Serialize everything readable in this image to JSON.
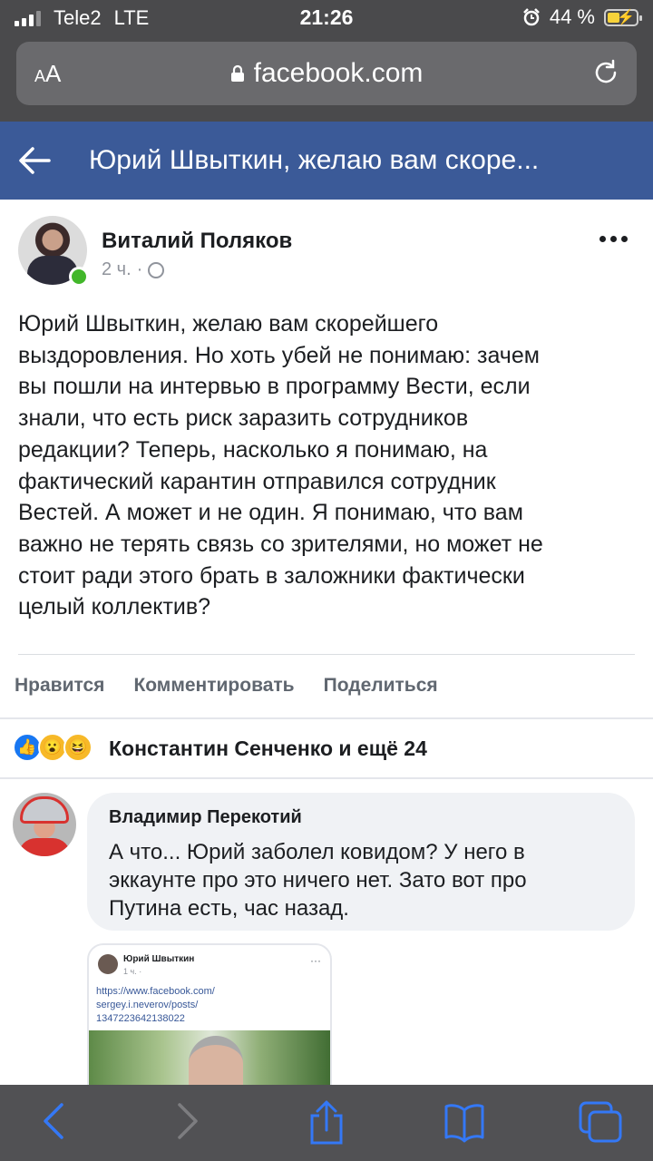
{
  "status_bar": {
    "carrier": "Tele2",
    "network": "LTE",
    "time": "21:26",
    "battery_percent": "44 %",
    "battery_level": 0.44
  },
  "safari": {
    "text_size_label": "AA",
    "url": "facebook.com"
  },
  "header": {
    "title": "Юрий Швыткин, желаю вам скоре..."
  },
  "post": {
    "author": "Виталий Поляков",
    "time": "2 ч.",
    "separator": "·",
    "lines": [
      "Юрий Швыткин, желаю вам скорейшего",
      "выздоровления. Но хоть убей не понимаю: зачем",
      "вы пошли на интервью в программу Вести, если",
      "знали, что есть риск заразить сотрудников",
      "редакции? Теперь, насколько я понимаю, на",
      "фактический карантин отправился сотрудник",
      "Вестей. А может и не один. Я понимаю, что вам",
      "важно не терять связь со зрителями, но может не",
      "стоит ради этого брать в заложники фактически",
      "целый коллектив?"
    ]
  },
  "actions": {
    "like": "Нравится",
    "comment": "Комментировать",
    "share": "Поделиться"
  },
  "reactions": {
    "summary": "Константин Сенченко и ещё 24",
    "icons": [
      "like-icon",
      "wow-icon",
      "haha-icon"
    ]
  },
  "comment": {
    "author": "Владимир Перекотий",
    "lines": [
      "А что... Юрий заболел ковидом? У него в",
      "эккаунте про это ничего нет. Зато вот про",
      "Путина есть, час назад."
    ]
  },
  "attachment": {
    "author": "Юрий Швыткин",
    "time": "1 ч. ·",
    "link_lines": [
      "https://www.facebook.com/",
      "sergey.i.neverov/posts/",
      "1347223642138022"
    ]
  },
  "colors": {
    "fb_blue": "#3b5a98",
    "ios_blue": "#3478f6",
    "online_green": "#42b72a"
  }
}
